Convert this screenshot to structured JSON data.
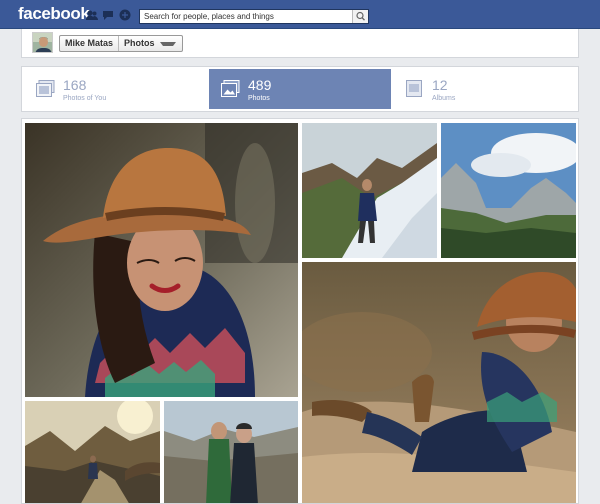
{
  "header": {
    "logo": "facebook",
    "search_placeholder": "Search for people, places and things",
    "icons": [
      "friends-icon",
      "messages-icon",
      "notifications-icon",
      "search-icon"
    ]
  },
  "profile": {
    "name": "Mike Matas",
    "section": "Photos"
  },
  "tabs": [
    {
      "count": "168",
      "label": "Photos of You",
      "icon": "photos-of-you-icon",
      "active": false
    },
    {
      "count": "489",
      "label": "Photos",
      "icon": "photos-icon",
      "active": true
    },
    {
      "count": "12",
      "label": "Albums",
      "icon": "albums-icon",
      "active": false
    }
  ],
  "photos": [
    "woman-in-hat-portrait",
    "hiker-on-snowy-slope",
    "yosemite-valley-landscape",
    "woman-sitting-on-rock",
    "hiker-on-trail",
    "couple-portrait"
  ],
  "colors": {
    "brand_blue": "#3b5998",
    "active_tab": "#6d84b4",
    "inactive_tab_text": "#9aa6c2"
  }
}
